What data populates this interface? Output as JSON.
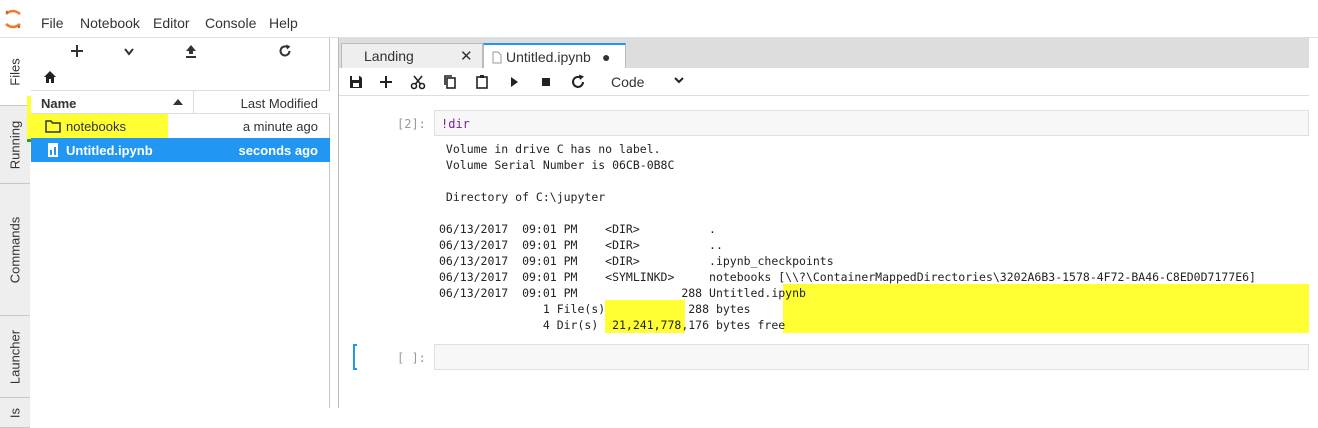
{
  "menu": {
    "items": [
      "File",
      "Notebook",
      "Editor",
      "Console",
      "Help"
    ]
  },
  "side_tabs": [
    "Files",
    "Running",
    "Commands",
    "Launcher",
    "Is"
  ],
  "filebrowser": {
    "toolbar_icons": [
      "plus-icon",
      "chevron-down-icon",
      "upload-icon",
      "refresh-icon"
    ],
    "header": {
      "name": "Name",
      "modified": "Last Modified"
    },
    "rows": [
      {
        "name": "notebooks",
        "modified": "a minute ago",
        "icon": "folder-icon"
      },
      {
        "name": "Untitled.ipynb",
        "modified": "seconds ago",
        "icon": "notebook-icon"
      }
    ]
  },
  "tabs": [
    {
      "label": "Landing",
      "close": "✕"
    },
    {
      "label": "Untitled.ipynb",
      "close": "●"
    }
  ],
  "toolbar": {
    "cell_type": "Code"
  },
  "cell1": {
    "prompt": "[2]:",
    "code": "!dir",
    "output": [
      " Volume in drive C has no label.",
      " Volume Serial Number is 06CB-0B8C",
      "",
      " Directory of C:\\jupyter",
      "",
      "06/13/2017  09:01 PM    <DIR>          .",
      "06/13/2017  09:01 PM    <DIR>          ..",
      "06/13/2017  09:01 PM    <DIR>          .ipynb_checkpoints",
      "06/13/2017  09:01 PM    <SYMLINKD>     notebooks [\\\\?\\ContainerMappedDirectories\\3202A6B3-1578-4F72-BA46-C8ED0D7177E6]",
      "06/13/2017  09:01 PM               288 Untitled.ipynb",
      "               1 File(s)            288 bytes",
      "               4 Dir(s)  21,241,778,176 bytes free"
    ]
  },
  "cell2": {
    "prompt": "[ ]:"
  },
  "colors": {
    "accent": "#2196f3",
    "highlight": "#ffff33"
  }
}
